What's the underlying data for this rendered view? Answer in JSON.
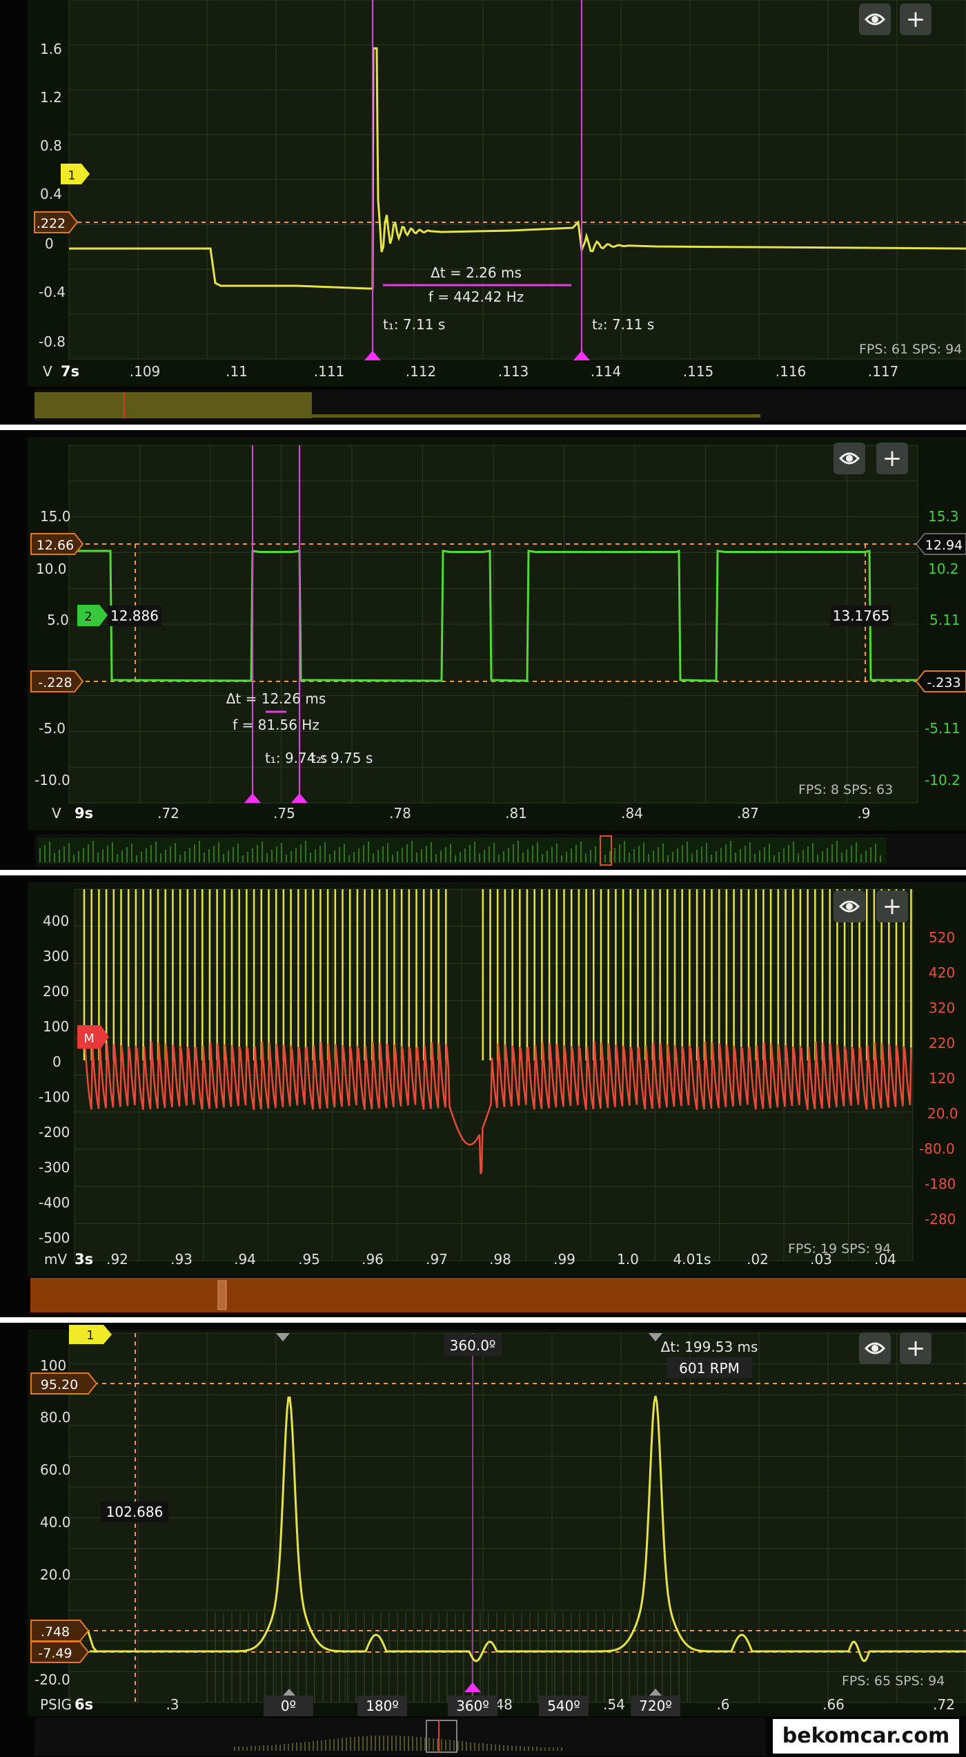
{
  "watermark": "bekomcar.com",
  "icons": {
    "visibility": "eye-icon",
    "add": "plus-icon"
  },
  "colors": {
    "yellow_trace": "#e6e24a",
    "green_trace": "#55d83a",
    "red_trace": "#e84a3a",
    "cursor_magenta": "#e040e0",
    "marker_orange": "#ff9a3a",
    "label_red": "#e85040",
    "label_green": "#40d040",
    "grid": "#2d3a22"
  },
  "panels": [
    {
      "id": "p1",
      "fps_label": "FPS: 61  SPS: 94",
      "unit_label": "V",
      "time_label": "7s",
      "channel_badge": "1",
      "y_ticks_left": [
        "1.6",
        "1.2",
        "0.8",
        "0.4",
        "0",
        "-0.4",
        "-0.8"
      ],
      "x_ticks": [
        ".109",
        ".11",
        ".111",
        ".112",
        ".113",
        ".114",
        ".115",
        ".116",
        ".117"
      ],
      "level_labels": [
        ".222"
      ],
      "cursor_readouts": {
        "delta": "Δt = 2.26 ms",
        "freq": "f = 442.42 Hz",
        "t1": "t₁: 7.11 s",
        "t2": "t₂: 7.11 s"
      }
    },
    {
      "id": "p2",
      "fps_label": "FPS: 8  SPS: 63",
      "unit_label": "V",
      "time_label": "9s",
      "channel_badge": "2",
      "y_ticks_left": [
        "15.0",
        "10.0",
        "5.0",
        "-5.0",
        "-10.0"
      ],
      "y_ticks_right": [
        "15.3",
        "10.2",
        "5.11",
        "-5.11",
        "-10.2"
      ],
      "x_ticks": [
        ".72",
        ".75",
        ".78",
        ".81",
        ".84",
        ".87",
        ".9"
      ],
      "level_labels_left": [
        "12.66",
        "-.228"
      ],
      "level_labels_right": [
        "12.94",
        "-.233"
      ],
      "value_boxes": [
        "12.886",
        "13.1765"
      ],
      "cursor_readouts": {
        "delta": "Δt = 12.26 ms",
        "freq": "f = 81.56 Hz",
        "t1": "t₁: 9.74 s",
        "t2": "t₂: 9.75 s"
      }
    },
    {
      "id": "p3",
      "fps_label": "FPS: 19  SPS: 94",
      "unit_label": "mV",
      "time_label": "3s",
      "channel_badge": "M",
      "y_ticks_left": [
        "400",
        "300",
        "200",
        "100",
        "0",
        "-100",
        "-200",
        "-300",
        "-400",
        "-500"
      ],
      "y_ticks_right": [
        "520",
        "420",
        "320",
        "220",
        "120",
        "20.0",
        "-80.0",
        "-180",
        "-280"
      ],
      "x_ticks": [
        ".92",
        ".93",
        ".94",
        ".95",
        ".96",
        ".97",
        ".98",
        ".99",
        "1.0",
        "4.01s",
        ".02",
        ".03",
        ".04"
      ]
    },
    {
      "id": "p4",
      "fps_label": "FPS: 65  SPS: 94",
      "unit_label": "PSIG",
      "time_label": "6s",
      "channel_badge": "1",
      "y_ticks_left": [
        "100",
        "80.0",
        "60.0",
        "40.0",
        "20.0",
        "-20.0"
      ],
      "x_ticks": [
        ".3",
        ".48",
        ".54",
        ".6",
        ".66",
        ".72"
      ],
      "degree_labels": [
        "0º",
        "180º",
        "360º",
        "540º",
        "720º"
      ],
      "level_labels": [
        "95.20",
        ".748",
        "-7.49"
      ],
      "value_box": "102.686",
      "top_degree": "360.0º",
      "cursor_readouts": {
        "delta": "Δt: 199.53 ms",
        "rpm": "601 RPM"
      }
    }
  ]
}
